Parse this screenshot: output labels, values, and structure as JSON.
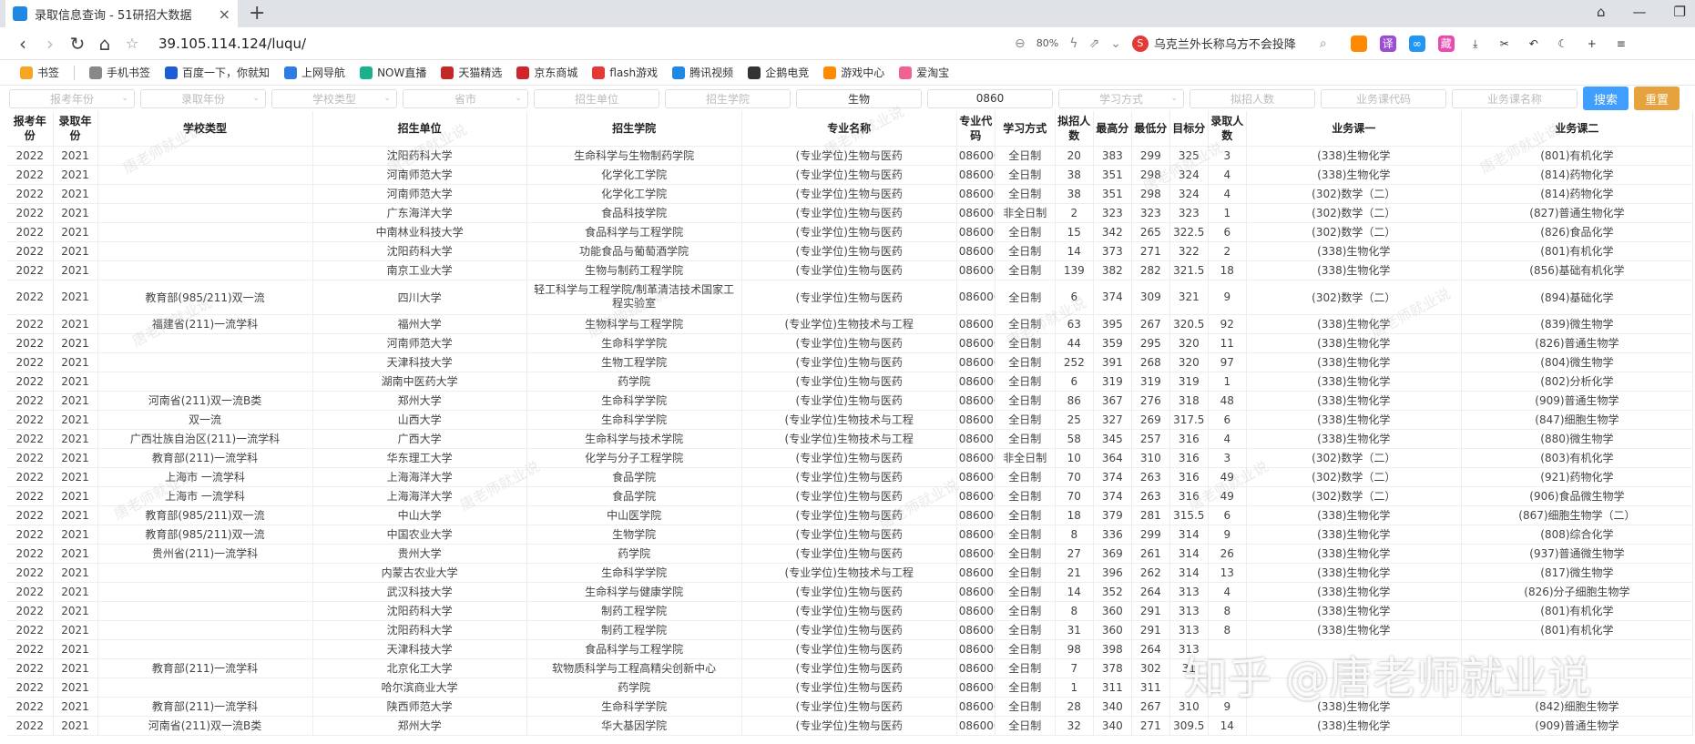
{
  "tab": {
    "title": "录取信息查询 - 51研招大数据",
    "close": "×",
    "new": "+"
  },
  "window": {
    "pin": "⌂",
    "minimize": "—",
    "restore": "❐"
  },
  "address": {
    "url": "39.105.114.124/luqu/",
    "zoom": "80%",
    "search_text": "乌克兰外长称乌方不会投降"
  },
  "bookmarks": [
    "书签",
    "手机书签",
    "百度一下，你就知",
    "上网导航",
    "NOW直播",
    "天猫精选",
    "京东商城",
    "flash游戏",
    "腾讯视频",
    "企鹅电竞",
    "游戏中心",
    "爱淘宝"
  ],
  "filters": [
    {
      "label": "报考年份",
      "value": false
    },
    {
      "label": "录取年份",
      "value": false
    },
    {
      "label": "学校类型",
      "value": false
    },
    {
      "label": "省市",
      "value": false
    },
    {
      "label": "招生单位",
      "value": false
    },
    {
      "label": "招生学院",
      "value": false
    },
    {
      "label": "生物",
      "value": true
    },
    {
      "label": "0860",
      "value": true
    },
    {
      "label": "学习方式",
      "value": false
    },
    {
      "label": "拟招人数",
      "value": false
    },
    {
      "label": "业务课代码",
      "value": false
    },
    {
      "label": "业务课名称",
      "value": false
    }
  ],
  "buttons": {
    "search": "搜索",
    "reset": "重置"
  },
  "columns": [
    "报考年份",
    "录取年份",
    "学校类型",
    "招生单位",
    "招生学院",
    "专业名称",
    "专业代码",
    "学习方式",
    "拟招人数",
    "最高分",
    "最低分",
    "目标分",
    "录取人数",
    "业务课一",
    "业务课二"
  ],
  "rows": [
    [
      "2022",
      "2021",
      "",
      "沈阳药科大学",
      "生命科学与生物制药学院",
      "(专业学位)生物与医药",
      "086000",
      "全日制",
      "20",
      "383",
      "299",
      "325",
      "3",
      "(338)生物化学",
      "(801)有机化学"
    ],
    [
      "2022",
      "2021",
      "",
      "河南师范大学",
      "化学化工学院",
      "(专业学位)生物与医药",
      "086000",
      "全日制",
      "38",
      "351",
      "298",
      "324",
      "4",
      "(338)生物化学",
      "(814)药物化学"
    ],
    [
      "2022",
      "2021",
      "",
      "河南师范大学",
      "化学化工学院",
      "(专业学位)生物与医药",
      "086000",
      "全日制",
      "38",
      "351",
      "298",
      "324",
      "4",
      "(302)数学（二）",
      "(814)药物化学"
    ],
    [
      "2022",
      "2021",
      "",
      "广东海洋大学",
      "食品科技学院",
      "(专业学位)生物与医药",
      "086000",
      "非全日制",
      "2",
      "323",
      "323",
      "323",
      "1",
      "(302)数学（二）",
      "(827)普通生物化学"
    ],
    [
      "2022",
      "2021",
      "",
      "中南林业科技大学",
      "食品科学与工程学院",
      "(专业学位)生物与医药",
      "086000",
      "全日制",
      "15",
      "342",
      "265",
      "322.5",
      "6",
      "(302)数学（二）",
      "(826)食品化学"
    ],
    [
      "2022",
      "2021",
      "",
      "沈阳药科大学",
      "功能食品与葡萄酒学院",
      "(专业学位)生物与医药",
      "086000",
      "全日制",
      "14",
      "373",
      "271",
      "322",
      "2",
      "(338)生物化学",
      "(801)有机化学"
    ],
    [
      "2022",
      "2021",
      "",
      "南京工业大学",
      "生物与制药工程学院",
      "(专业学位)生物与医药",
      "086000",
      "全日制",
      "139",
      "382",
      "282",
      "321.5",
      "18",
      "(338)生物化学",
      "(856)基础有机化学"
    ],
    [
      "2022",
      "2021",
      "教育部(985/211)双一流",
      "四川大学",
      "轻工科学与工程学院/制革清洁技术国家工程实验室",
      "(专业学位)生物与医药",
      "086000",
      "全日制",
      "6",
      "374",
      "309",
      "321",
      "9",
      "(302)数学（二）",
      "(894)基础化学"
    ],
    [
      "2022",
      "2021",
      "福建省(211)一流学科",
      "福州大学",
      "生物科学与工程学院",
      "(专业学位)生物技术与工程",
      "086001",
      "全日制",
      "63",
      "395",
      "267",
      "320.5",
      "92",
      "(338)生物化学",
      "(839)微生物学"
    ],
    [
      "2022",
      "2021",
      "",
      "河南师范大学",
      "生命科学学院",
      "(专业学位)生物与医药",
      "086000",
      "全日制",
      "44",
      "359",
      "295",
      "320",
      "11",
      "(338)生物化学",
      "(826)普通生物学"
    ],
    [
      "2022",
      "2021",
      "",
      "天津科技大学",
      "生物工程学院",
      "(专业学位)生物与医药",
      "086000",
      "全日制",
      "252",
      "391",
      "268",
      "320",
      "97",
      "(338)生物化学",
      "(804)微生物学"
    ],
    [
      "2022",
      "2021",
      "",
      "湖南中医药大学",
      "药学院",
      "(专业学位)生物与医药",
      "086000",
      "全日制",
      "6",
      "319",
      "319",
      "319",
      "1",
      "(338)生物化学",
      "(802)分析化学"
    ],
    [
      "2022",
      "2021",
      "河南省(211)双一流B类",
      "郑州大学",
      "生命科学学院",
      "(专业学位)生物与医药",
      "086000",
      "全日制",
      "86",
      "367",
      "276",
      "318",
      "48",
      "(338)生物化学",
      "(909)普通生物学"
    ],
    [
      "2022",
      "2021",
      "双一流",
      "山西大学",
      "生命科学学院",
      "(专业学位)生物技术与工程",
      "086001",
      "全日制",
      "25",
      "327",
      "269",
      "317.5",
      "6",
      "(338)生物化学",
      "(847)细胞生物学"
    ],
    [
      "2022",
      "2021",
      "广西壮族自治区(211)一流学科",
      "广西大学",
      "生命科学与技术学院",
      "(专业学位)生物技术与工程",
      "086001",
      "全日制",
      "58",
      "345",
      "257",
      "316",
      "4",
      "(338)生物化学",
      "(880)微生物学"
    ],
    [
      "2022",
      "2021",
      "教育部(211)一流学科",
      "华东理工大学",
      "化学与分子工程学院",
      "(专业学位)生物与医药",
      "086000",
      "非全日制",
      "10",
      "364",
      "310",
      "316",
      "3",
      "(302)数学（二）",
      "(803)有机化学"
    ],
    [
      "2022",
      "2021",
      "上海市 一流学科",
      "上海海洋大学",
      "食品学院",
      "(专业学位)生物与医药",
      "086000",
      "全日制",
      "70",
      "374",
      "263",
      "316",
      "49",
      "(302)数学（二）",
      "(921)药物化学"
    ],
    [
      "2022",
      "2021",
      "上海市 一流学科",
      "上海海洋大学",
      "食品学院",
      "(专业学位)生物与医药",
      "086000",
      "全日制",
      "70",
      "374",
      "263",
      "316",
      "49",
      "(302)数学（二）",
      "(906)食品微生物学"
    ],
    [
      "2022",
      "2021",
      "教育部(985/211)双一流",
      "中山大学",
      "中山医学院",
      "(专业学位)生物与医药",
      "086000",
      "全日制",
      "18",
      "379",
      "281",
      "315.5",
      "6",
      "(338)生物化学",
      "(867)细胞生物学（二）"
    ],
    [
      "2022",
      "2021",
      "教育部(985/211)双一流",
      "中国农业大学",
      "生物学院",
      "(专业学位)生物与医药",
      "086000",
      "全日制",
      "8",
      "336",
      "299",
      "314",
      "9",
      "(338)生物化学",
      "(808)综合化学"
    ],
    [
      "2022",
      "2021",
      "贵州省(211)一流学科",
      "贵州大学",
      "药学院",
      "(专业学位)生物与医药",
      "086000",
      "全日制",
      "27",
      "369",
      "261",
      "314",
      "26",
      "(338)生物化学",
      "(937)普通微生物学"
    ],
    [
      "2022",
      "2021",
      "",
      "内蒙古农业大学",
      "生命科学学院",
      "(专业学位)生物技术与工程",
      "086001",
      "全日制",
      "21",
      "396",
      "262",
      "314",
      "13",
      "(338)生物化学",
      "(817)微生物学"
    ],
    [
      "2022",
      "2021",
      "",
      "武汉科技大学",
      "生命科学与健康学院",
      "(专业学位)生物与医药",
      "086000",
      "全日制",
      "14",
      "352",
      "264",
      "313",
      "4",
      "(338)生物化学",
      "(826)分子细胞生物学"
    ],
    [
      "2022",
      "2021",
      "",
      "沈阳药科大学",
      "制药工程学院",
      "(专业学位)生物与医药",
      "086000",
      "全日制",
      "8",
      "360",
      "291",
      "313",
      "8",
      "(338)生物化学",
      "(801)有机化学"
    ],
    [
      "2022",
      "2021",
      "",
      "沈阳药科大学",
      "制药工程学院",
      "(专业学位)生物与医药",
      "086000",
      "全日制",
      "31",
      "360",
      "291",
      "313",
      "8",
      "(338)生物化学",
      "(801)有机化学"
    ],
    [
      "2022",
      "2021",
      "",
      "天津科技大学",
      "食品科学与工程学院",
      "(专业学位)生物与医药",
      "086000",
      "全日制",
      "98",
      "398",
      "264",
      "313",
      "",
      "",
      ""
    ],
    [
      "2022",
      "2021",
      "教育部(211)一流学科",
      "北京化工大学",
      "软物质科学与工程高精尖创新中心",
      "(专业学位)生物与医药",
      "086000",
      "全日制",
      "7",
      "378",
      "302",
      "31",
      "",
      "",
      ""
    ],
    [
      "2022",
      "2021",
      "",
      "哈尔滨商业大学",
      "药学院",
      "(专业学位)生物与医药",
      "086000",
      "全日制",
      "1",
      "311",
      "311",
      "",
      "",
      "",
      ""
    ],
    [
      "2022",
      "2021",
      "教育部(211)一流学科",
      "陕西师范大学",
      "生命科学学院",
      "(专业学位)生物与医药",
      "086000",
      "全日制",
      "28",
      "340",
      "267",
      "310",
      "9",
      "(338)生物化学",
      "(842)细胞生物学"
    ],
    [
      "2022",
      "2021",
      "河南省(211)双一流B类",
      "郑州大学",
      "华大基因学院",
      "(专业学位)生物与医药",
      "086000",
      "全日制",
      "32",
      "340",
      "271",
      "309.5",
      "14",
      "(338)生物化学",
      "(909)普通生物学"
    ]
  ],
  "watermark": "唐老师就业说",
  "brand": "知乎 @唐老师就业说"
}
